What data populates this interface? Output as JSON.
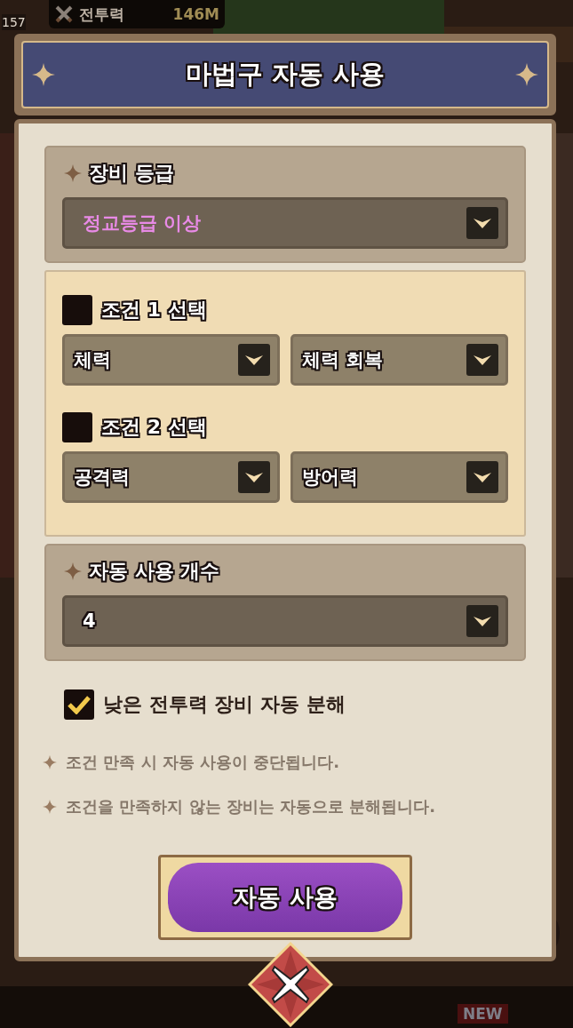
{
  "hud": {
    "level": "157",
    "power_label": "전투력",
    "power_value": "146M",
    "new_badge": "NEW"
  },
  "dialog": {
    "title": "마법구 자동 사용",
    "grade": {
      "label": "장비 등급",
      "value": "정교등급 이상"
    },
    "conditions": [
      {
        "label": "조건 1 선택",
        "checked": false,
        "options": [
          "체력",
          "체력 회복"
        ]
      },
      {
        "label": "조건 2 선택",
        "checked": false,
        "options": [
          "공격력",
          "방어력"
        ]
      }
    ],
    "count": {
      "label": "자동 사용 개수",
      "value": "4"
    },
    "disassemble": {
      "label": "낮은 전투력 장비 자동 분해",
      "checked": true
    },
    "notes": [
      "조건 만족 시 자동 사용이 중단됩니다.",
      "조건을 만족하지 않는 장비는 자동으로 분해됩니다."
    ],
    "action_button": "자동 사용"
  }
}
